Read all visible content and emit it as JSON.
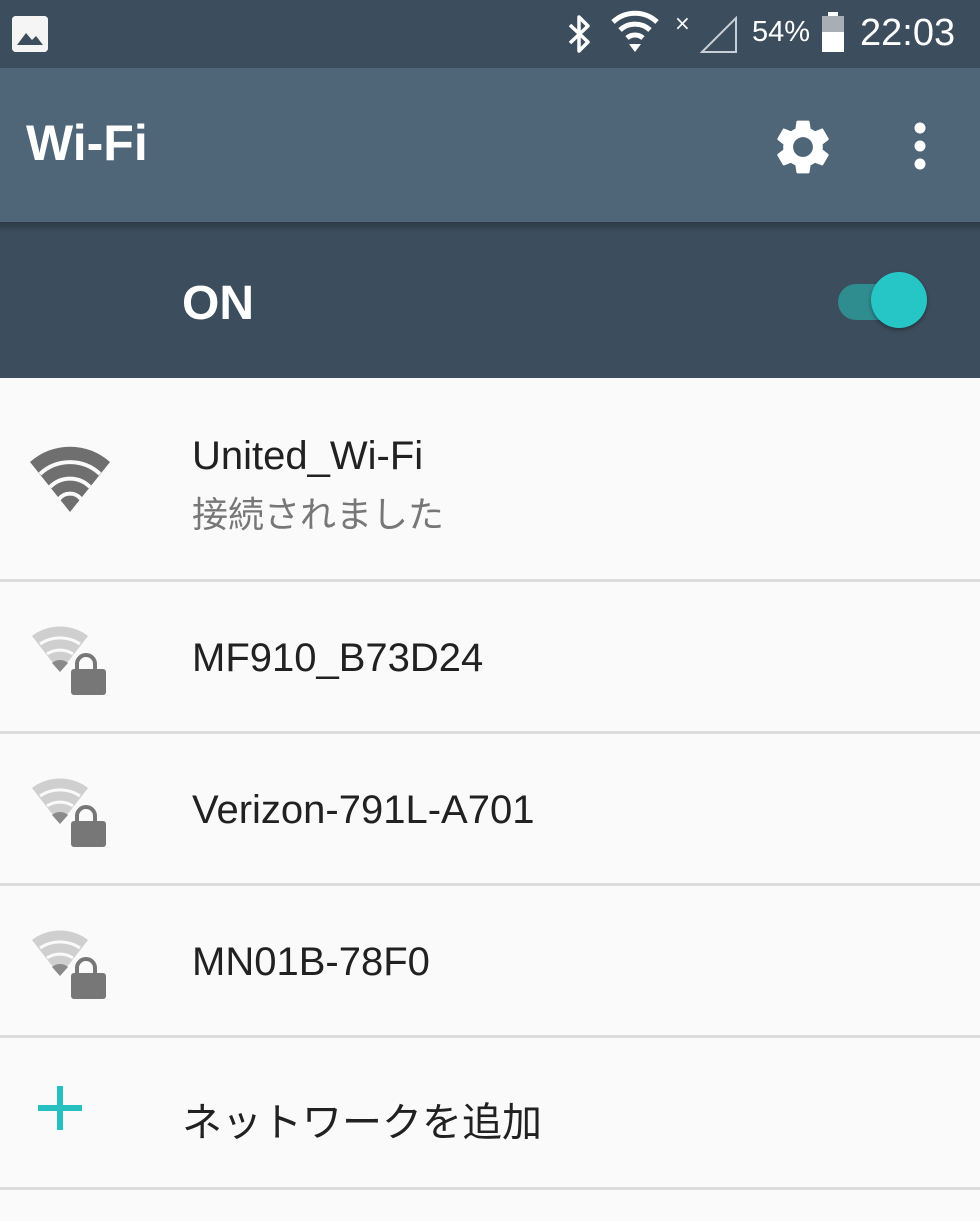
{
  "status_bar": {
    "icons": [
      "image-icon",
      "bluetooth-icon",
      "wifi-icon",
      "no-signal-icon",
      "battery-icon"
    ],
    "battery_percent": "54%",
    "time": "22:03"
  },
  "app_bar": {
    "title": "Wi-Fi",
    "actions": [
      "gear-icon",
      "more-vert-icon"
    ]
  },
  "wifi_toggle": {
    "label": "ON",
    "state": "on",
    "accent_color": "#26c6c6"
  },
  "networks": [
    {
      "ssid": "United_Wi-Fi",
      "status": "接続されました",
      "secured": false
    },
    {
      "ssid": "MF910_B73D24",
      "secured": true
    },
    {
      "ssid": "Verizon-791L-A701",
      "secured": true
    },
    {
      "ssid": "MN01B-78F0",
      "secured": true
    }
  ],
  "add_network": {
    "label": "ネットワークを追加",
    "icon": "plus-icon"
  },
  "colors": {
    "status_bar": "#3c4d5d",
    "app_bar": "#4f6578",
    "toggle_row": "#3c4d5d",
    "accent": "#26c6c6"
  }
}
